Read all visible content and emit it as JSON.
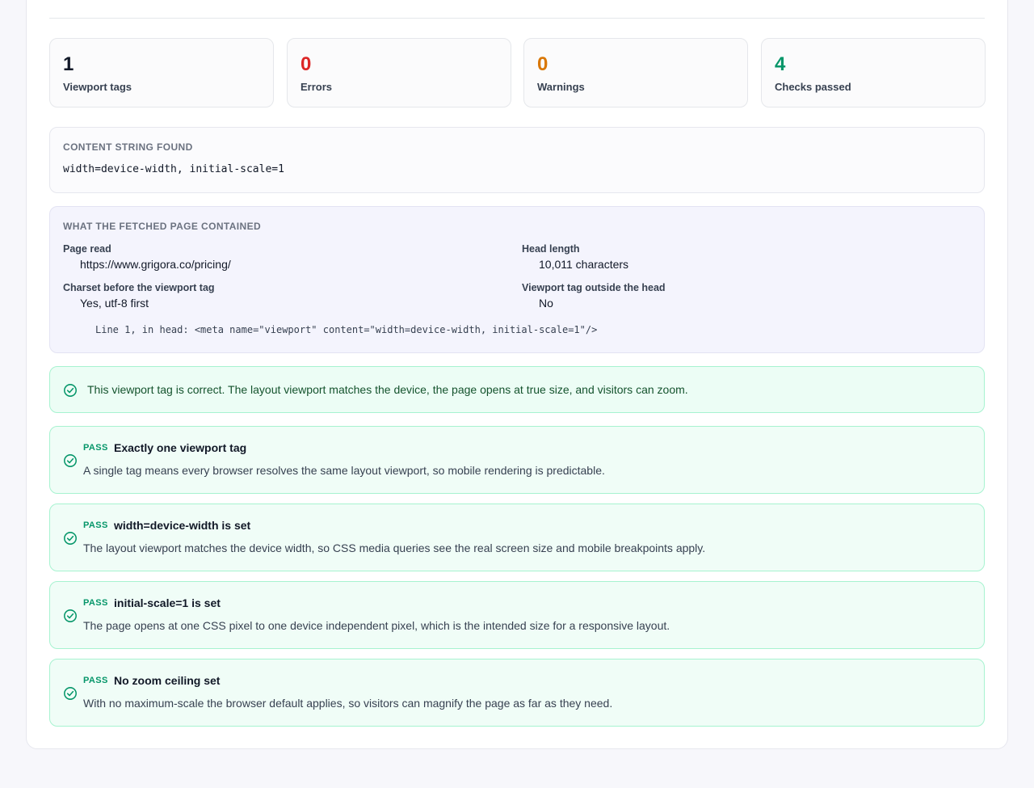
{
  "stats": [
    {
      "value": "1",
      "label": "Viewport tags",
      "color": "#111827"
    },
    {
      "value": "0",
      "label": "Errors",
      "color": "#dc2626"
    },
    {
      "value": "0",
      "label": "Warnings",
      "color": "#d97706"
    },
    {
      "value": "4",
      "label": "Checks passed",
      "color": "#059669"
    }
  ],
  "content_string": {
    "heading": "CONTENT STRING FOUND",
    "value": "width=device-width, initial-scale=1"
  },
  "fetched": {
    "heading": "WHAT THE FETCHED PAGE CONTAINED",
    "page_read_label": "Page read",
    "page_read_value": "https://www.grigora.co/pricing/",
    "head_length_label": "Head length",
    "head_length_value": "10,011 characters",
    "charset_label": "Charset before the viewport tag",
    "charset_value": "Yes, utf-8 first",
    "outside_label": "Viewport tag outside the head",
    "outside_value": "No",
    "source_line": "Line 1, in head: <meta name=\"viewport\" content=\"width=device-width, initial-scale=1\"/>"
  },
  "summary": {
    "text": "This viewport tag is correct. The layout viewport matches the device, the page opens at true size, and visitors can zoom.",
    "icon": "check-circle-icon"
  },
  "checks": [
    {
      "status": "PASS",
      "title": "Exactly one viewport tag",
      "description": "A single tag means every browser resolves the same layout viewport, so mobile rendering is predictable."
    },
    {
      "status": "PASS",
      "title": "width=device-width is set",
      "description": "The layout viewport matches the device width, so CSS media queries see the real screen size and mobile breakpoints apply."
    },
    {
      "status": "PASS",
      "title": "initial-scale=1 is set",
      "description": "The page opens at one CSS pixel to one device independent pixel, which is the intended size for a responsive layout."
    },
    {
      "status": "PASS",
      "title": "No zoom ceiling set",
      "description": "With no maximum-scale the browser default applies, so visitors can magnify the page as far as they need."
    }
  ],
  "colors": {
    "pass": "#059669",
    "success_bg": "#ecfdf5",
    "success_border": "#a7f3d0",
    "fetched_bg": "#f4f4fd"
  }
}
